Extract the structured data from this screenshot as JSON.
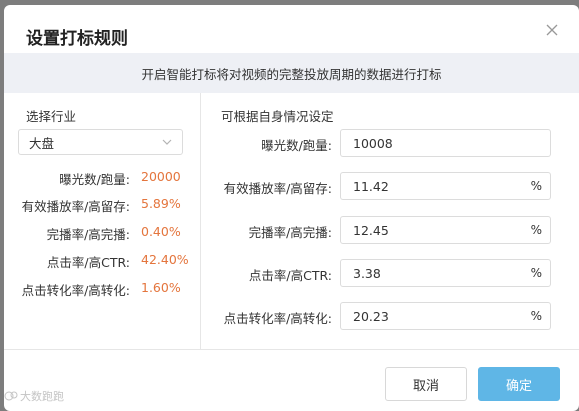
{
  "modal": {
    "title": "设置打标规则",
    "banner": "开启智能打标将对视频的完整投放周期的数据进行打标"
  },
  "left": {
    "section_title": "选择行业",
    "industry_selected": "大盘",
    "stats": [
      {
        "label": "曝光数/跑量:",
        "value": "20000"
      },
      {
        "label": "有效播放率/高留存:",
        "value": "5.89%"
      },
      {
        "label": "完播率/高完播:",
        "value": "0.40%"
      },
      {
        "label": "点击率/高CTR:",
        "value": "42.40%"
      },
      {
        "label": "点击转化率/高转化:",
        "value": "1.60%"
      }
    ]
  },
  "right": {
    "section_title": "可根据自身情况设定",
    "fields": [
      {
        "label": "曝光数/跑量:",
        "value": "10008",
        "unit": ""
      },
      {
        "label": "有效播放率/高留存:",
        "value": "11.42",
        "unit": "%"
      },
      {
        "label": "完播率/高完播:",
        "value": "12.45",
        "unit": "%"
      },
      {
        "label": "点击率/高CTR:",
        "value": "3.38",
        "unit": "%"
      },
      {
        "label": "点击转化率/高转化:",
        "value": "20.23",
        "unit": "%"
      }
    ]
  },
  "footer": {
    "cancel_label": "取消",
    "ok_label": "确定"
  },
  "watermark": "大数跑跑",
  "colors": {
    "accent_value": "#e4753d",
    "primary_button": "#5fb6e6",
    "banner_bg": "#eef0f5"
  }
}
